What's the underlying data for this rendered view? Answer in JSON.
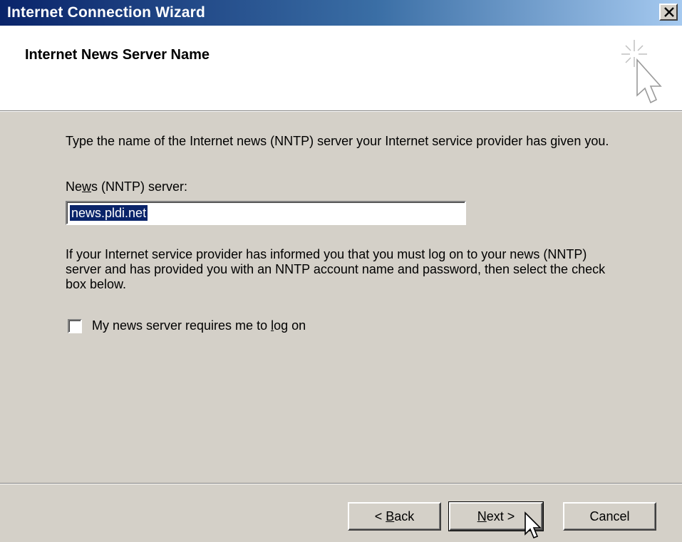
{
  "window": {
    "title": "Internet Connection Wizard",
    "close_symbol": "×"
  },
  "header": {
    "heading": "Internet News Server Name",
    "icon": "wizard-cursor-icon"
  },
  "body": {
    "intro": "Type the name of the Internet news (NNTP) server your Internet service provider has given you.",
    "server_label_prefix": "Ne",
    "server_label_accel": "w",
    "server_label_suffix": "s (NNTP) server:",
    "server_value": "news.pldi.net",
    "info": "If your Internet service provider has informed you that you must log on to your news (NNTP) server and has provided you with an NNTP account name and password, then select the check box below.",
    "logon_checkbox": {
      "label_prefix": "My news server requires me to ",
      "label_accel": "l",
      "label_suffix": "og on",
      "checked": false
    }
  },
  "buttons": {
    "back_prefix": "< ",
    "back_accel": "B",
    "back_suffix": "ack",
    "next_accel": "N",
    "next_suffix": "ext >",
    "cancel": "Cancel"
  },
  "colors": {
    "title_bar_start": "#0a246a",
    "title_bar_end": "#a6caf0",
    "face": "#d4d0c8",
    "selection": "#0a246a"
  }
}
